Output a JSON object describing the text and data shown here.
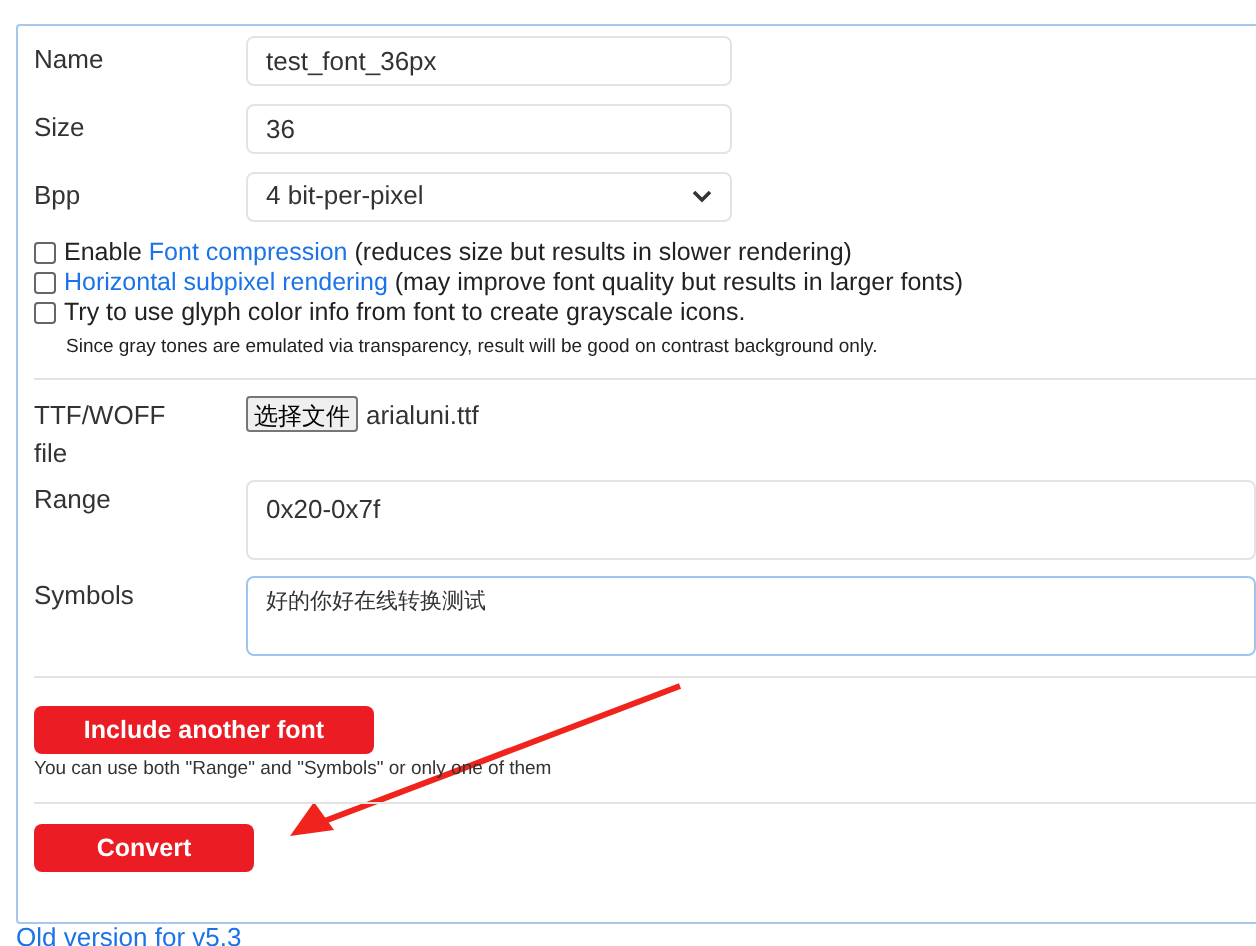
{
  "fields": [
    {
      "kind": "text",
      "label": "Name",
      "value": "test_font_36px"
    },
    {
      "kind": "text",
      "label": "Size",
      "value": "36"
    },
    {
      "kind": "select",
      "label": "Bpp",
      "value": "4 bit-per-pixel"
    }
  ],
  "options": [
    {
      "checked": false,
      "segments": [
        {
          "kind": "text",
          "text": "Enable "
        },
        {
          "kind": "link",
          "text": "Font compression"
        },
        {
          "kind": "text",
          "text": " (reduces size but results in slower rendering)"
        }
      ]
    },
    {
      "checked": false,
      "segments": [
        {
          "kind": "link",
          "text": "Horizontal subpixel rendering"
        },
        {
          "kind": "text",
          "text": " (may improve font quality but results in larger fonts)"
        }
      ]
    },
    {
      "checked": false,
      "segments": [
        {
          "kind": "text",
          "text": "Try to use glyph color info from font to create grayscale icons."
        }
      ]
    }
  ],
  "options_note": "Since gray tones are emulated via transparency, result will be good on contrast background only.",
  "font": {
    "file_label": "TTF/WOFF file",
    "file_button": "选择文件",
    "file_name": "arialuni.ttf",
    "range_label": "Range",
    "range_value": "0x20-0x7f",
    "symbols_label": "Symbols",
    "symbols_value": "好的你好在线转换测试"
  },
  "include_button": "Include another font",
  "include_note": "You can use both \"Range\" and \"Symbols\" or only one of them",
  "convert_button": "Convert",
  "old_version_link": "Old version for v5.3"
}
